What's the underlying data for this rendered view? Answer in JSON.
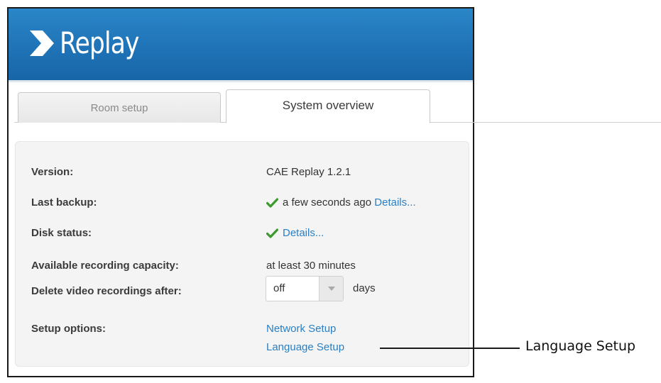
{
  "app": {
    "name": "Replay"
  },
  "tabs": [
    {
      "label": "Room setup",
      "active": false
    },
    {
      "label": "System overview",
      "active": true
    }
  ],
  "overview": {
    "version": {
      "label": "Version:",
      "value": "CAE Replay 1.2.1"
    },
    "last_backup": {
      "label": "Last backup:",
      "status_icon": "check-icon",
      "value": "a few seconds ago",
      "link": "Details..."
    },
    "disk_status": {
      "label": "Disk status:",
      "status_icon": "check-icon",
      "link": "Details..."
    },
    "capacity": {
      "label": "Available recording capacity:",
      "value": "at least 30 minutes"
    },
    "delete_after": {
      "label": "Delete video recordings after:",
      "selected": "off",
      "unit": "days"
    },
    "setup_options": {
      "label": "Setup options:",
      "links": [
        "Network Setup",
        "Language Setup"
      ]
    }
  },
  "callout": {
    "text": "Language Setup"
  },
  "colors": {
    "header": "#1f73b6",
    "link": "#2a7fc4",
    "check": "#3a9a2c"
  }
}
